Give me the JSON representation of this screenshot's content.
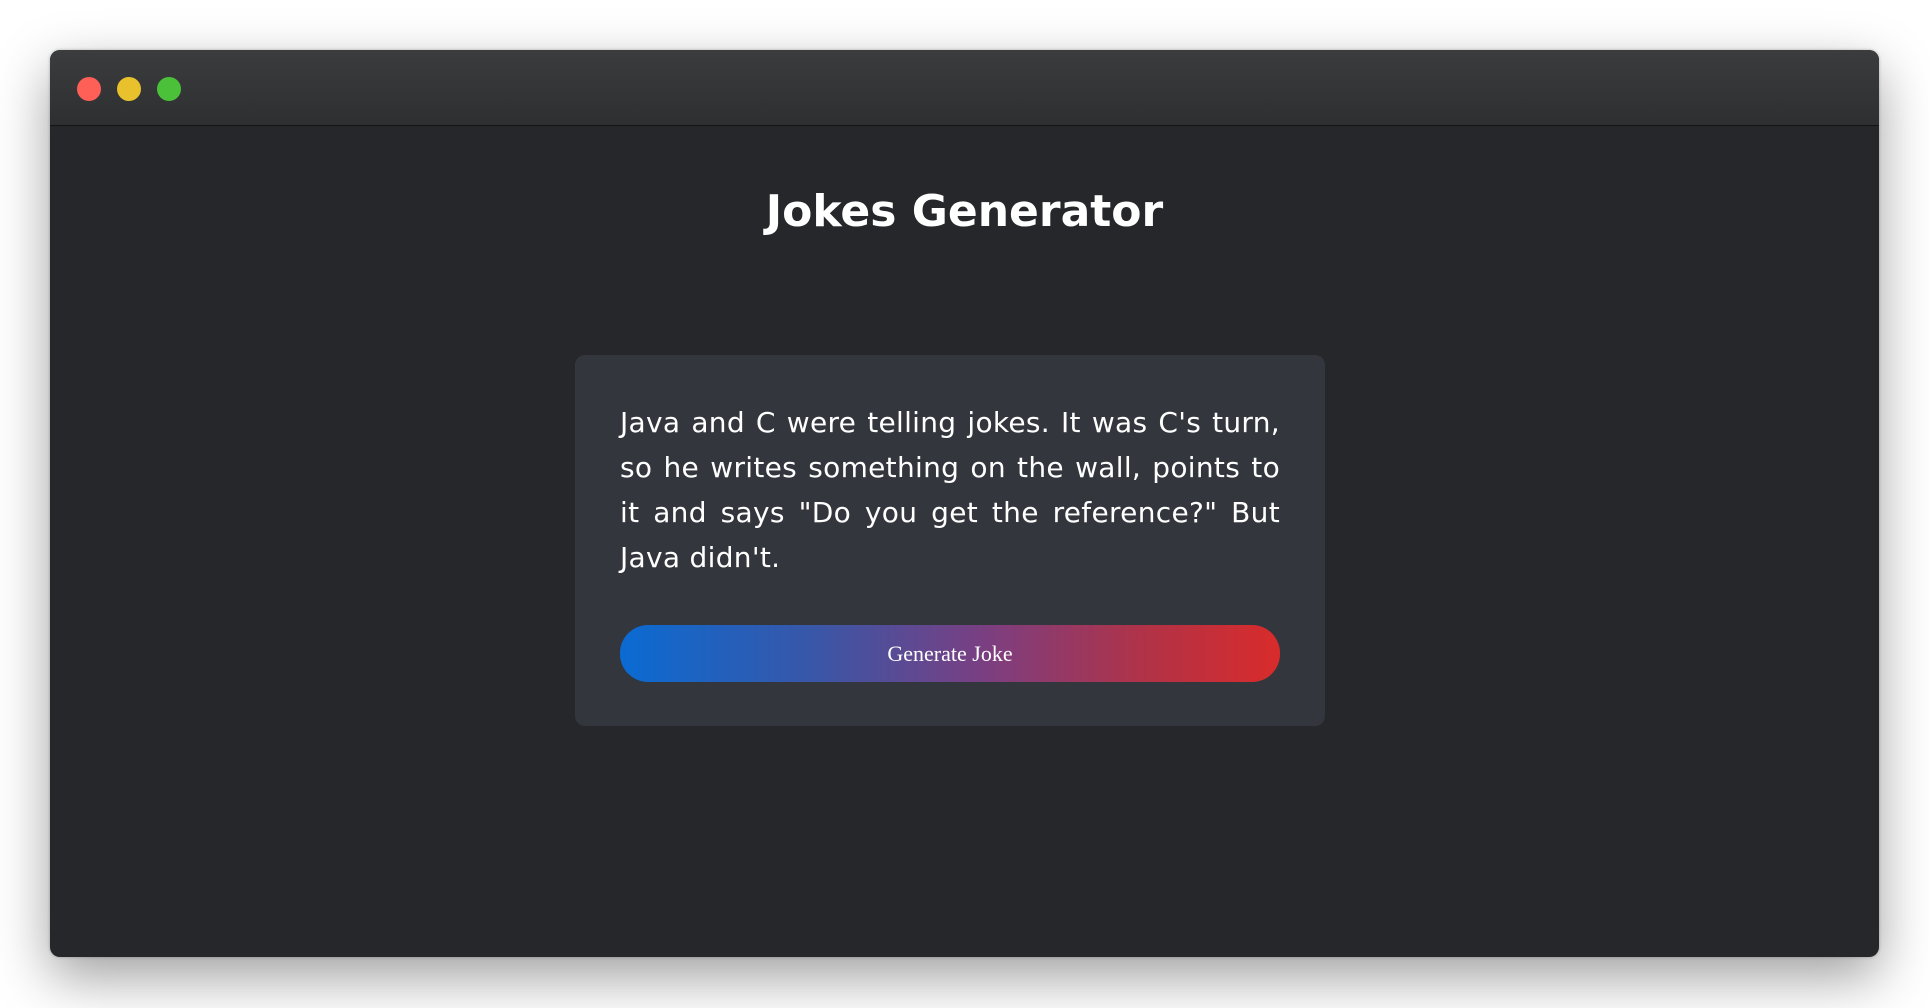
{
  "window": {
    "controls": [
      "close",
      "minimize",
      "maximize"
    ]
  },
  "page": {
    "title": "Jokes Generator"
  },
  "joke": {
    "text": "Java and C were telling jokes. It was C's turn, so he writes something on the wall, points to it and says \"Do you get the reference?\" But Java didn't."
  },
  "actions": {
    "generate_label": "Generate Joke"
  },
  "colors": {
    "window_background": "#26272a",
    "card_background": "#33363c",
    "button_gradient_start": "#0a6bd3",
    "button_gradient_end": "#d92b2b"
  }
}
